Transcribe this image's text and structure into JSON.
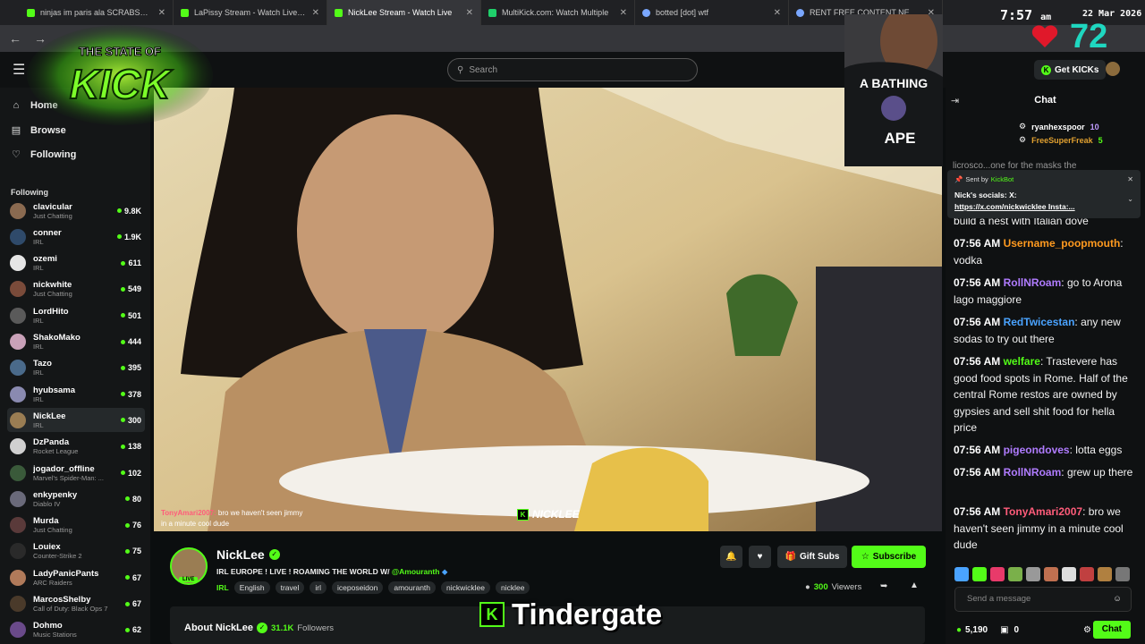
{
  "browser": {
    "tabs": [
      {
        "title": "ninjas im paris ala SCRABSNYC",
        "active": false
      },
      {
        "title": "LaPissy Stream - Watch Live on",
        "active": false
      },
      {
        "title": "NickLee Stream - Watch Live",
        "active": true
      },
      {
        "title": "MultiKick.com: Watch Multiple",
        "active": false
      },
      {
        "title": "botted [dot] wtf",
        "active": false
      },
      {
        "title": "RENT FREE CONTENT NETWOR",
        "active": false
      }
    ]
  },
  "overlay": {
    "logo_line1": "THE STATE OF",
    "logo_line2": "KICK",
    "time": "7:57",
    "ampm": "am",
    "date": "22 Mar 2026",
    "heart_count": "72",
    "webcam_shirt_top": "A BATHING",
    "webcam_shirt_bottom": "APE",
    "bottom_caption": "Tindergate"
  },
  "header": {
    "search_placeholder": "Search",
    "get_kicks": "Get KICKs"
  },
  "sidebar": {
    "nav": [
      {
        "label": "Home",
        "icon": "home-icon"
      },
      {
        "label": "Browse",
        "icon": "browse-icon"
      },
      {
        "label": "Following",
        "icon": "heart-icon"
      }
    ],
    "following_label": "Following",
    "channels": [
      {
        "name": "clavicular",
        "category": "Just Chatting",
        "viewers": "9.8K",
        "color": "#8a6a50"
      },
      {
        "name": "conner",
        "category": "IRL",
        "viewers": "1.9K",
        "color": "#2f4a6a"
      },
      {
        "name": "ozemi",
        "category": "IRL",
        "viewers": "611",
        "color": "#e5e5e5"
      },
      {
        "name": "nickwhite",
        "category": "Just Chatting",
        "viewers": "549",
        "color": "#7a4b3a"
      },
      {
        "name": "LordHito",
        "category": "IRL",
        "viewers": "501",
        "color": "#5a5a5a"
      },
      {
        "name": "ShakoMako",
        "category": "IRL",
        "viewers": "444",
        "color": "#c9a1b8"
      },
      {
        "name": "Tazo",
        "category": "IRL",
        "viewers": "395",
        "color": "#4a6a8a"
      },
      {
        "name": "hyubsama",
        "category": "IRL",
        "viewers": "378",
        "color": "#8a8ab0"
      },
      {
        "name": "NickLee",
        "category": "IRL",
        "viewers": "300",
        "color": "#9a7d53",
        "active": true
      },
      {
        "name": "DzPanda",
        "category": "Rocket League",
        "viewers": "138",
        "color": "#d0d0d0"
      },
      {
        "name": "jogador_offline",
        "category": "Marvel's Spider-Man: ...",
        "viewers": "102",
        "color": "#3a5a3a"
      },
      {
        "name": "enkypenky",
        "category": "Diablo IV",
        "viewers": "80",
        "color": "#6a6a7a"
      },
      {
        "name": "Murda",
        "category": "Just Chatting",
        "viewers": "76",
        "color": "#5a3a3a"
      },
      {
        "name": "Louiex",
        "category": "Counter-Strike 2",
        "viewers": "75",
        "color": "#2a2a2a"
      },
      {
        "name": "LadyPanicPants",
        "category": "ARC Raiders",
        "viewers": "67",
        "color": "#b07a5a"
      },
      {
        "name": "MarcosShelby",
        "category": "Call of Duty: Black Ops 7",
        "viewers": "67",
        "color": "#4a3a2a"
      },
      {
        "name": "Dohmo",
        "category": "Music Stations",
        "viewers": "62",
        "color": "#6a4a8a"
      }
    ]
  },
  "video": {
    "caption_user": "TonyAmari2007:",
    "caption_text_1": "bro we haven't seen jimmy",
    "caption_text_2": "in a minute cool dude",
    "watermark": "NICKLEE"
  },
  "stream": {
    "name": "NickLee",
    "live": "LIVE",
    "title": "IRL EUROPE ! LIVE ! ROAMING THE WORLD W/",
    "mention": "@Amouranth",
    "category": "IRL",
    "tags": [
      "English",
      "travel",
      "irl",
      "iceposeidon",
      "amouranth",
      "nickwicklee",
      "nicklee"
    ],
    "gift_subs": "Gift Subs",
    "subscribe": "Subscribe",
    "viewers_count": "300",
    "viewers_label": "Viewers",
    "about_label": "About NickLee",
    "followers_count": "31.1K",
    "followers_label": "Followers"
  },
  "chat": {
    "title": "Chat",
    "gifters": [
      {
        "name": "ryanhexspoor",
        "count": "10"
      },
      {
        "name": "FreeSuperFreak",
        "count": "5"
      }
    ],
    "cut_text": "licrosco...one for the masks the",
    "pinned": {
      "sent_by": "Sent by",
      "bot": "KickBot",
      "line1": "Nick's socials: X:",
      "line2": "https://x.com/nickwicklee Insta:..."
    },
    "messages": [
      {
        "time": "",
        "user": "",
        "color": "#fff",
        "text": "build a nest with Italian dove"
      },
      {
        "time": "07:56 AM",
        "user": "Username_poopmouth",
        "color": "#ff9a1f",
        "text": "vodka"
      },
      {
        "time": "07:56 AM",
        "user": "RollNRoam",
        "color": "#b07cff",
        "text": "go to Arona lago maggiore"
      },
      {
        "time": "07:56 AM",
        "user": "RedTwicestan",
        "color": "#4aa3ff",
        "text": "any new sodas to try out there"
      },
      {
        "time": "07:56 AM",
        "user": "welfare",
        "color": "#53fc18",
        "text": "Trastevere has good food spots in Rome. Half of the central Rome restos are owned by gypsies and sell shit food for hella price"
      },
      {
        "time": "07:56 AM",
        "user": "pigeondoves",
        "color": "#b07cff",
        "text": "lotta eggs"
      },
      {
        "time": "07:56 AM",
        "user": "RollNRoam",
        "color": "#b07cff",
        "text": "grew up there"
      },
      {
        "time": "07:56 AM",
        "user": "TonyAmari2007",
        "color": "#ff5c7a",
        "text": "bro we haven't seen jimmy in a minute cool dude"
      }
    ],
    "input_placeholder": "Send a message",
    "points": "5,190",
    "drops": "0",
    "chat_button": "Chat"
  }
}
